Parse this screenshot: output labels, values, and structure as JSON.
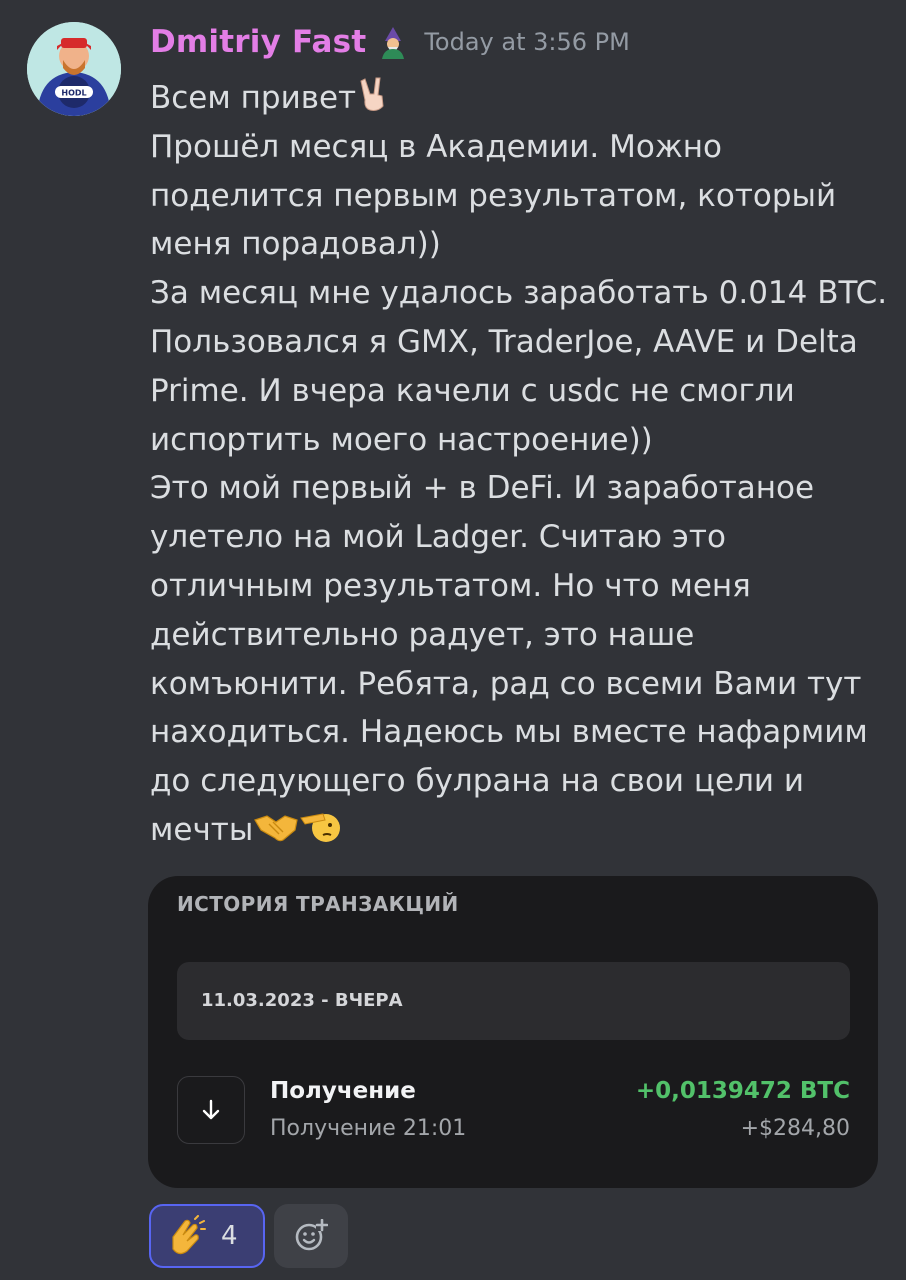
{
  "message": {
    "username": "Dmitriy Fast",
    "timestamp": "Today at 3:56 PM",
    "avatar_text": "HODL",
    "lines": [
      "Всем привет",
      "Прошёл месяц в Академии. Можно",
      "поделится первым результатом, который",
      "меня порадовал))",
      "За месяц мне удалось заработать 0.014 BTC.",
      "Пользовался я GMX, TraderJoe, AAVE и Delta",
      "Prime. И вчера качели с usdc не смогли",
      "испортить моего настроение))",
      "Это мой первый + в DeFi. И заработаное",
      "улетело на мой Ladger. Считаю это",
      "отличным результатом. Но что меня",
      "действительно радует, это наше",
      "комъюнити. Ребята, рад со всеми Вами тут",
      "находиться. Надеюсь мы вместе нафармим",
      "до следующего булрана на свои цели и",
      "мечты"
    ]
  },
  "embed": {
    "title": "ИСТОРИЯ ТРАНЗАКЦИЙ",
    "date_label": "11.03.2023 - ВЧЕРА",
    "transaction": {
      "title": "Получение",
      "subtitle": "Получение 21:01",
      "amount": "+0,0139472 BTC",
      "usd": "+$284,80"
    }
  },
  "reactions": [
    {
      "emoji": "clapping-hands-icon",
      "count": "4"
    }
  ],
  "icons": {
    "name_badge": "mage-emoji-icon",
    "line1_emoji": "victory-hand-icon",
    "last_line_emojis": [
      "handshake-icon",
      "saluting-face-icon"
    ],
    "add_reaction": "add-reaction-icon"
  },
  "colors": {
    "background": "#313338",
    "username": "#e37ee6",
    "amount_positive": "#52c16a",
    "reaction_border": "#5865f2"
  }
}
